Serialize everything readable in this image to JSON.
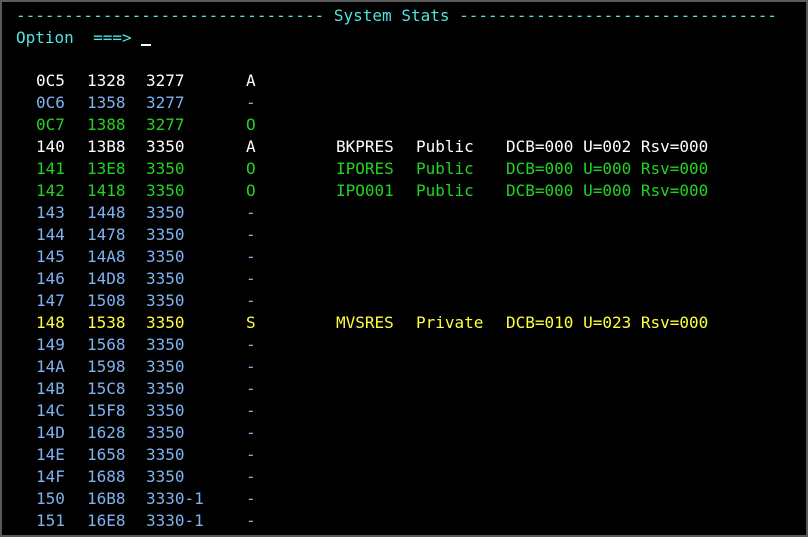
{
  "screen": {
    "title_left": "-------------------------------- ",
    "title": "System Stats",
    "title_right": " ---------------------------------",
    "option_label": "Option",
    "option_prompt": "===>"
  },
  "colors": {
    "white": "#ffffff",
    "blue": "#7fb2f0",
    "green": "#22d322",
    "yellow": "#ffff3c",
    "cyan": "#4fe3e3"
  },
  "devices": [
    {
      "addr": "0C5",
      "cuu": "1328",
      "type": "3277",
      "status": "A",
      "volser": "",
      "use": "",
      "dcb": "",
      "color": "white"
    },
    {
      "addr": "0C6",
      "cuu": "1358",
      "type": "3277",
      "status": "-",
      "volser": "",
      "use": "",
      "dcb": "",
      "color": "blue"
    },
    {
      "addr": "0C7",
      "cuu": "1388",
      "type": "3277",
      "status": "O",
      "volser": "",
      "use": "",
      "dcb": "",
      "color": "green"
    },
    {
      "addr": "140",
      "cuu": "13B8",
      "type": "3350",
      "status": "A",
      "volser": "BKPRES",
      "use": "Public",
      "dcb": "DCB=000 U=002 Rsv=000",
      "color": "white"
    },
    {
      "addr": "141",
      "cuu": "13E8",
      "type": "3350",
      "status": "O",
      "volser": "IPORES",
      "use": "Public",
      "dcb": "DCB=000 U=000 Rsv=000",
      "color": "green"
    },
    {
      "addr": "142",
      "cuu": "1418",
      "type": "3350",
      "status": "O",
      "volser": "IPO001",
      "use": "Public",
      "dcb": "DCB=000 U=000 Rsv=000",
      "color": "green"
    },
    {
      "addr": "143",
      "cuu": "1448",
      "type": "3350",
      "status": "-",
      "volser": "",
      "use": "",
      "dcb": "",
      "color": "blue"
    },
    {
      "addr": "144",
      "cuu": "1478",
      "type": "3350",
      "status": "-",
      "volser": "",
      "use": "",
      "dcb": "",
      "color": "blue"
    },
    {
      "addr": "145",
      "cuu": "14A8",
      "type": "3350",
      "status": "-",
      "volser": "",
      "use": "",
      "dcb": "",
      "color": "blue"
    },
    {
      "addr": "146",
      "cuu": "14D8",
      "type": "3350",
      "status": "-",
      "volser": "",
      "use": "",
      "dcb": "",
      "color": "blue"
    },
    {
      "addr": "147",
      "cuu": "1508",
      "type": "3350",
      "status": "-",
      "volser": "",
      "use": "",
      "dcb": "",
      "color": "blue"
    },
    {
      "addr": "148",
      "cuu": "1538",
      "type": "3350",
      "status": "S",
      "volser": "MVSRES",
      "use": "Private",
      "dcb": "DCB=010 U=023 Rsv=000",
      "color": "yellow"
    },
    {
      "addr": "149",
      "cuu": "1568",
      "type": "3350",
      "status": "-",
      "volser": "",
      "use": "",
      "dcb": "",
      "color": "blue"
    },
    {
      "addr": "14A",
      "cuu": "1598",
      "type": "3350",
      "status": "-",
      "volser": "",
      "use": "",
      "dcb": "",
      "color": "blue"
    },
    {
      "addr": "14B",
      "cuu": "15C8",
      "type": "3350",
      "status": "-",
      "volser": "",
      "use": "",
      "dcb": "",
      "color": "blue"
    },
    {
      "addr": "14C",
      "cuu": "15F8",
      "type": "3350",
      "status": "-",
      "volser": "",
      "use": "",
      "dcb": "",
      "color": "blue"
    },
    {
      "addr": "14D",
      "cuu": "1628",
      "type": "3350",
      "status": "-",
      "volser": "",
      "use": "",
      "dcb": "",
      "color": "blue"
    },
    {
      "addr": "14E",
      "cuu": "1658",
      "type": "3350",
      "status": "-",
      "volser": "",
      "use": "",
      "dcb": "",
      "color": "blue"
    },
    {
      "addr": "14F",
      "cuu": "1688",
      "type": "3350",
      "status": "-",
      "volser": "",
      "use": "",
      "dcb": "",
      "color": "blue"
    },
    {
      "addr": "150",
      "cuu": "16B8",
      "type": "3330-1",
      "status": "-",
      "volser": "",
      "use": "",
      "dcb": "",
      "color": "blue"
    },
    {
      "addr": "151",
      "cuu": "16E8",
      "type": "3330-1",
      "status": "-",
      "volser": "",
      "use": "",
      "dcb": "",
      "color": "blue"
    }
  ]
}
